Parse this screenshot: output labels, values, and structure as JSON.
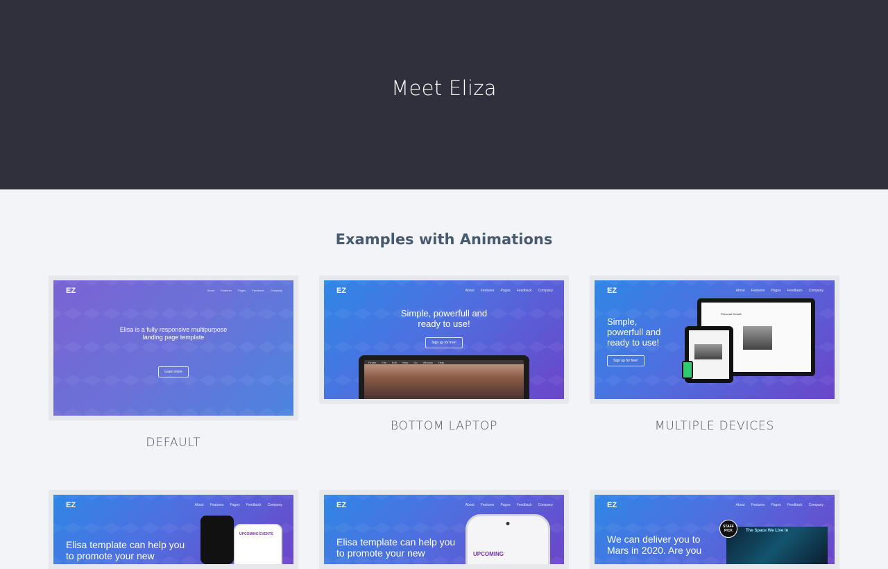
{
  "hero": {
    "title": "Meet Eliza"
  },
  "section": {
    "title": "Examples with Animations"
  },
  "nav_items": [
    "About",
    "Features",
    "Pages",
    "Feedback",
    "Company"
  ],
  "logo": "EZ",
  "cards": [
    {
      "caption": "DEFAULT",
      "headline_line1": "Elisa is a fully responsive multipurpose",
      "headline_line2": "landing page template",
      "button": "Learn more"
    },
    {
      "caption": "BOTTOM LAPTOP",
      "headline_line1": "Simple, powerfull and",
      "headline_line2": "ready to use!",
      "button": "Sign up for free!",
      "menubar": [
        "Finder",
        "File",
        "Edit",
        "View",
        "Go",
        "Window",
        "Help"
      ]
    },
    {
      "caption": "MULTIPLE DEVICES",
      "headline_line1": "Simple,",
      "headline_line2": "powerfull and",
      "headline_line3": "ready to use!",
      "button": "Sign up for free!",
      "screen_title": "Personal Growth"
    },
    {
      "headline_line1": "Elisa template can help you",
      "headline_line2": "to promote your new",
      "app_label": "UPCOMING EVENTS"
    },
    {
      "headline_line1": "Elisa template can help you",
      "headline_line2": "to promote your new",
      "app_label": "UPCOMING"
    },
    {
      "headline_line1": "We can deliver you to",
      "headline_line2": "Mars in 2020. Are you",
      "badge": "STAFF PICK",
      "video_title": "The Space We Live In"
    }
  ]
}
